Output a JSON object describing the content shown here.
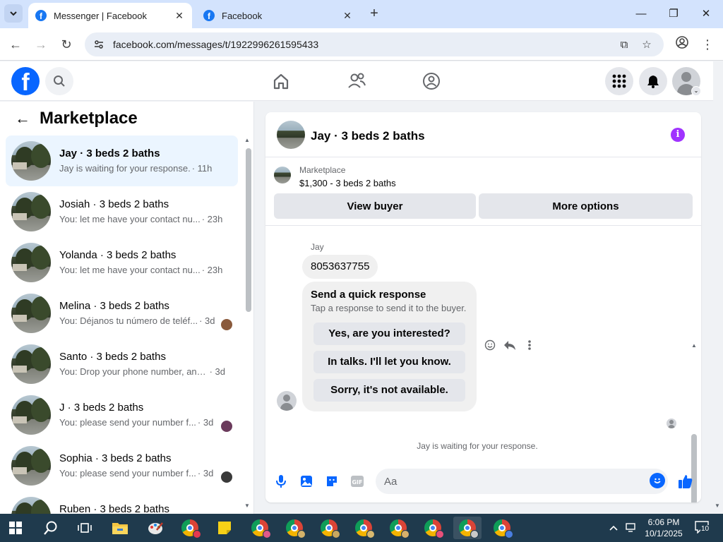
{
  "browser": {
    "tabs": [
      {
        "title": "Messenger | Facebook",
        "active": true
      },
      {
        "title": "Facebook",
        "active": false
      }
    ],
    "url": "facebook.com/messages/t/1922996261595433"
  },
  "left_panel": {
    "title": "Marketplace",
    "conversations": [
      {
        "title": "Jay · 3 beds 2 baths",
        "preview": "Jay is waiting for your response.",
        "time": "· 11h",
        "selected": true,
        "seen_color": ""
      },
      {
        "title": "Josiah · 3 beds 2 baths",
        "preview": "You: let me have your contact nu...",
        "time": "· 23h",
        "selected": false,
        "seen_color": ""
      },
      {
        "title": "Yolanda · 3 beds 2 baths",
        "preview": "You: let me have your contact nu...",
        "time": "· 23h",
        "selected": false,
        "seen_color": ""
      },
      {
        "title": "Melina · 3 beds 2 baths",
        "preview": "You: Déjanos tu número de teléf...",
        "time": "· 3d",
        "selected": false,
        "seen_color": "#8a5a3c"
      },
      {
        "title": "Santo · 3 beds 2 baths",
        "preview": "You: Drop your phone number, and...",
        "time": "· 3d",
        "selected": false,
        "seen_color": ""
      },
      {
        "title": "J · 3 beds 2 baths",
        "preview": "You: please send your number f...",
        "time": "· 3d",
        "selected": false,
        "seen_color": "#6b3b5c"
      },
      {
        "title": "Sophia · 3 beds 2 baths",
        "preview": "You: please send your number f...",
        "time": "· 3d",
        "selected": false,
        "seen_color": "#3a3a3a"
      },
      {
        "title": "Ruben · 3 beds 2 baths",
        "preview": "",
        "time": "",
        "selected": false,
        "seen_color": "#5a3a3a"
      }
    ]
  },
  "chat": {
    "title": "Jay · 3 beds 2 baths",
    "listing_source": "Marketplace",
    "listing_price": "$1,300 - 3 beds 2 baths",
    "view_buyer_label": "View buyer",
    "more_options_label": "More options",
    "sender_name": "Jay",
    "phone_message": "8053637755",
    "quick_response": {
      "title": "Send a quick response",
      "subtitle": "Tap a response to send it to the buyer.",
      "options": [
        "Yes, are you interested?",
        "In talks. I'll let you know.",
        "Sorry, it's not available."
      ]
    },
    "waiting_text": "Jay is waiting for your response.",
    "composer_placeholder": "Aa"
  },
  "taskbar": {
    "time": "6:06 PM",
    "date": "10/1/2025",
    "notification_count": "10"
  },
  "colors": {
    "facebook_blue": "#0866ff",
    "info_purple": "#a033ff",
    "selected_bg": "#ebf5ff",
    "taskbar": "#1f3a4d"
  }
}
